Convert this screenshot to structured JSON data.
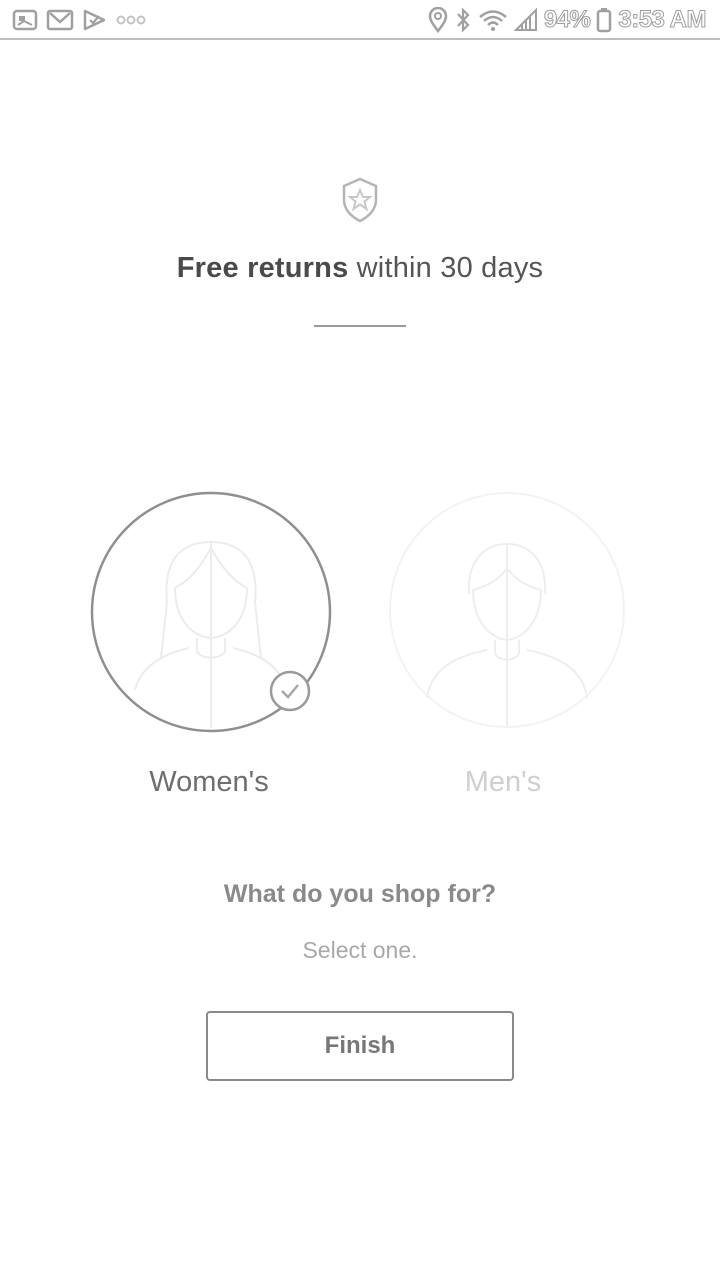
{
  "status_bar": {
    "left_icons": [
      "gallery-notification-icon",
      "gmail-notification-icon",
      "checklist-notification-icon",
      "more-notifications-icon"
    ],
    "right_icons": [
      "location-icon",
      "bluetooth-icon",
      "wifi-icon",
      "signal-icon",
      "battery-icon"
    ],
    "battery_percent": "94%",
    "time": "3:53 AM"
  },
  "header": {
    "badge_icon": "shield-star-icon",
    "headline_bold": "Free returns",
    "headline_rest": " within 30 days"
  },
  "options": [
    {
      "label": "Women's",
      "icon": "woman-avatar-icon",
      "selected": true
    },
    {
      "label": "Men's",
      "icon": "man-avatar-icon",
      "selected": false
    }
  ],
  "prompt": {
    "question": "What do you shop for?",
    "subtext": "Select one."
  },
  "actions": {
    "finish_label": "Finish"
  },
  "colors": {
    "selected_ring": "#8f8f8f",
    "unselected_ring": "#f2f2f2",
    "muted_text": "#a8a8a8"
  }
}
